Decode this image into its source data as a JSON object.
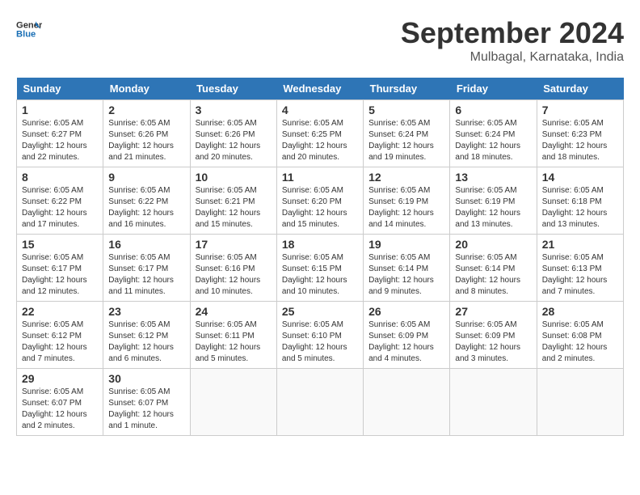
{
  "header": {
    "logo_line1": "General",
    "logo_line2": "Blue",
    "month_year": "September 2024",
    "location": "Mulbagal, Karnataka, India"
  },
  "days_of_week": [
    "Sunday",
    "Monday",
    "Tuesday",
    "Wednesday",
    "Thursday",
    "Friday",
    "Saturday"
  ],
  "weeks": [
    [
      {
        "day": "1",
        "sunrise": "6:05 AM",
        "sunset": "6:27 PM",
        "daylight": "12 hours and 22 minutes."
      },
      {
        "day": "2",
        "sunrise": "6:05 AM",
        "sunset": "6:26 PM",
        "daylight": "12 hours and 21 minutes."
      },
      {
        "day": "3",
        "sunrise": "6:05 AM",
        "sunset": "6:26 PM",
        "daylight": "12 hours and 20 minutes."
      },
      {
        "day": "4",
        "sunrise": "6:05 AM",
        "sunset": "6:25 PM",
        "daylight": "12 hours and 20 minutes."
      },
      {
        "day": "5",
        "sunrise": "6:05 AM",
        "sunset": "6:24 PM",
        "daylight": "12 hours and 19 minutes."
      },
      {
        "day": "6",
        "sunrise": "6:05 AM",
        "sunset": "6:24 PM",
        "daylight": "12 hours and 18 minutes."
      },
      {
        "day": "7",
        "sunrise": "6:05 AM",
        "sunset": "6:23 PM",
        "daylight": "12 hours and 18 minutes."
      }
    ],
    [
      {
        "day": "8",
        "sunrise": "6:05 AM",
        "sunset": "6:22 PM",
        "daylight": "12 hours and 17 minutes."
      },
      {
        "day": "9",
        "sunrise": "6:05 AM",
        "sunset": "6:22 PM",
        "daylight": "12 hours and 16 minutes."
      },
      {
        "day": "10",
        "sunrise": "6:05 AM",
        "sunset": "6:21 PM",
        "daylight": "12 hours and 15 minutes."
      },
      {
        "day": "11",
        "sunrise": "6:05 AM",
        "sunset": "6:20 PM",
        "daylight": "12 hours and 15 minutes."
      },
      {
        "day": "12",
        "sunrise": "6:05 AM",
        "sunset": "6:19 PM",
        "daylight": "12 hours and 14 minutes."
      },
      {
        "day": "13",
        "sunrise": "6:05 AM",
        "sunset": "6:19 PM",
        "daylight": "12 hours and 13 minutes."
      },
      {
        "day": "14",
        "sunrise": "6:05 AM",
        "sunset": "6:18 PM",
        "daylight": "12 hours and 13 minutes."
      }
    ],
    [
      {
        "day": "15",
        "sunrise": "6:05 AM",
        "sunset": "6:17 PM",
        "daylight": "12 hours and 12 minutes."
      },
      {
        "day": "16",
        "sunrise": "6:05 AM",
        "sunset": "6:17 PM",
        "daylight": "12 hours and 11 minutes."
      },
      {
        "day": "17",
        "sunrise": "6:05 AM",
        "sunset": "6:16 PM",
        "daylight": "12 hours and 10 minutes."
      },
      {
        "day": "18",
        "sunrise": "6:05 AM",
        "sunset": "6:15 PM",
        "daylight": "12 hours and 10 minutes."
      },
      {
        "day": "19",
        "sunrise": "6:05 AM",
        "sunset": "6:14 PM",
        "daylight": "12 hours and 9 minutes."
      },
      {
        "day": "20",
        "sunrise": "6:05 AM",
        "sunset": "6:14 PM",
        "daylight": "12 hours and 8 minutes."
      },
      {
        "day": "21",
        "sunrise": "6:05 AM",
        "sunset": "6:13 PM",
        "daylight": "12 hours and 7 minutes."
      }
    ],
    [
      {
        "day": "22",
        "sunrise": "6:05 AM",
        "sunset": "6:12 PM",
        "daylight": "12 hours and 7 minutes."
      },
      {
        "day": "23",
        "sunrise": "6:05 AM",
        "sunset": "6:12 PM",
        "daylight": "12 hours and 6 minutes."
      },
      {
        "day": "24",
        "sunrise": "6:05 AM",
        "sunset": "6:11 PM",
        "daylight": "12 hours and 5 minutes."
      },
      {
        "day": "25",
        "sunrise": "6:05 AM",
        "sunset": "6:10 PM",
        "daylight": "12 hours and 5 minutes."
      },
      {
        "day": "26",
        "sunrise": "6:05 AM",
        "sunset": "6:09 PM",
        "daylight": "12 hours and 4 minutes."
      },
      {
        "day": "27",
        "sunrise": "6:05 AM",
        "sunset": "6:09 PM",
        "daylight": "12 hours and 3 minutes."
      },
      {
        "day": "28",
        "sunrise": "6:05 AM",
        "sunset": "6:08 PM",
        "daylight": "12 hours and 2 minutes."
      }
    ],
    [
      {
        "day": "29",
        "sunrise": "6:05 AM",
        "sunset": "6:07 PM",
        "daylight": "12 hours and 2 minutes."
      },
      {
        "day": "30",
        "sunrise": "6:05 AM",
        "sunset": "6:07 PM",
        "daylight": "12 hours and 1 minute."
      },
      null,
      null,
      null,
      null,
      null
    ]
  ],
  "labels": {
    "sunrise": "Sunrise:",
    "sunset": "Sunset:",
    "daylight": "Daylight:"
  }
}
